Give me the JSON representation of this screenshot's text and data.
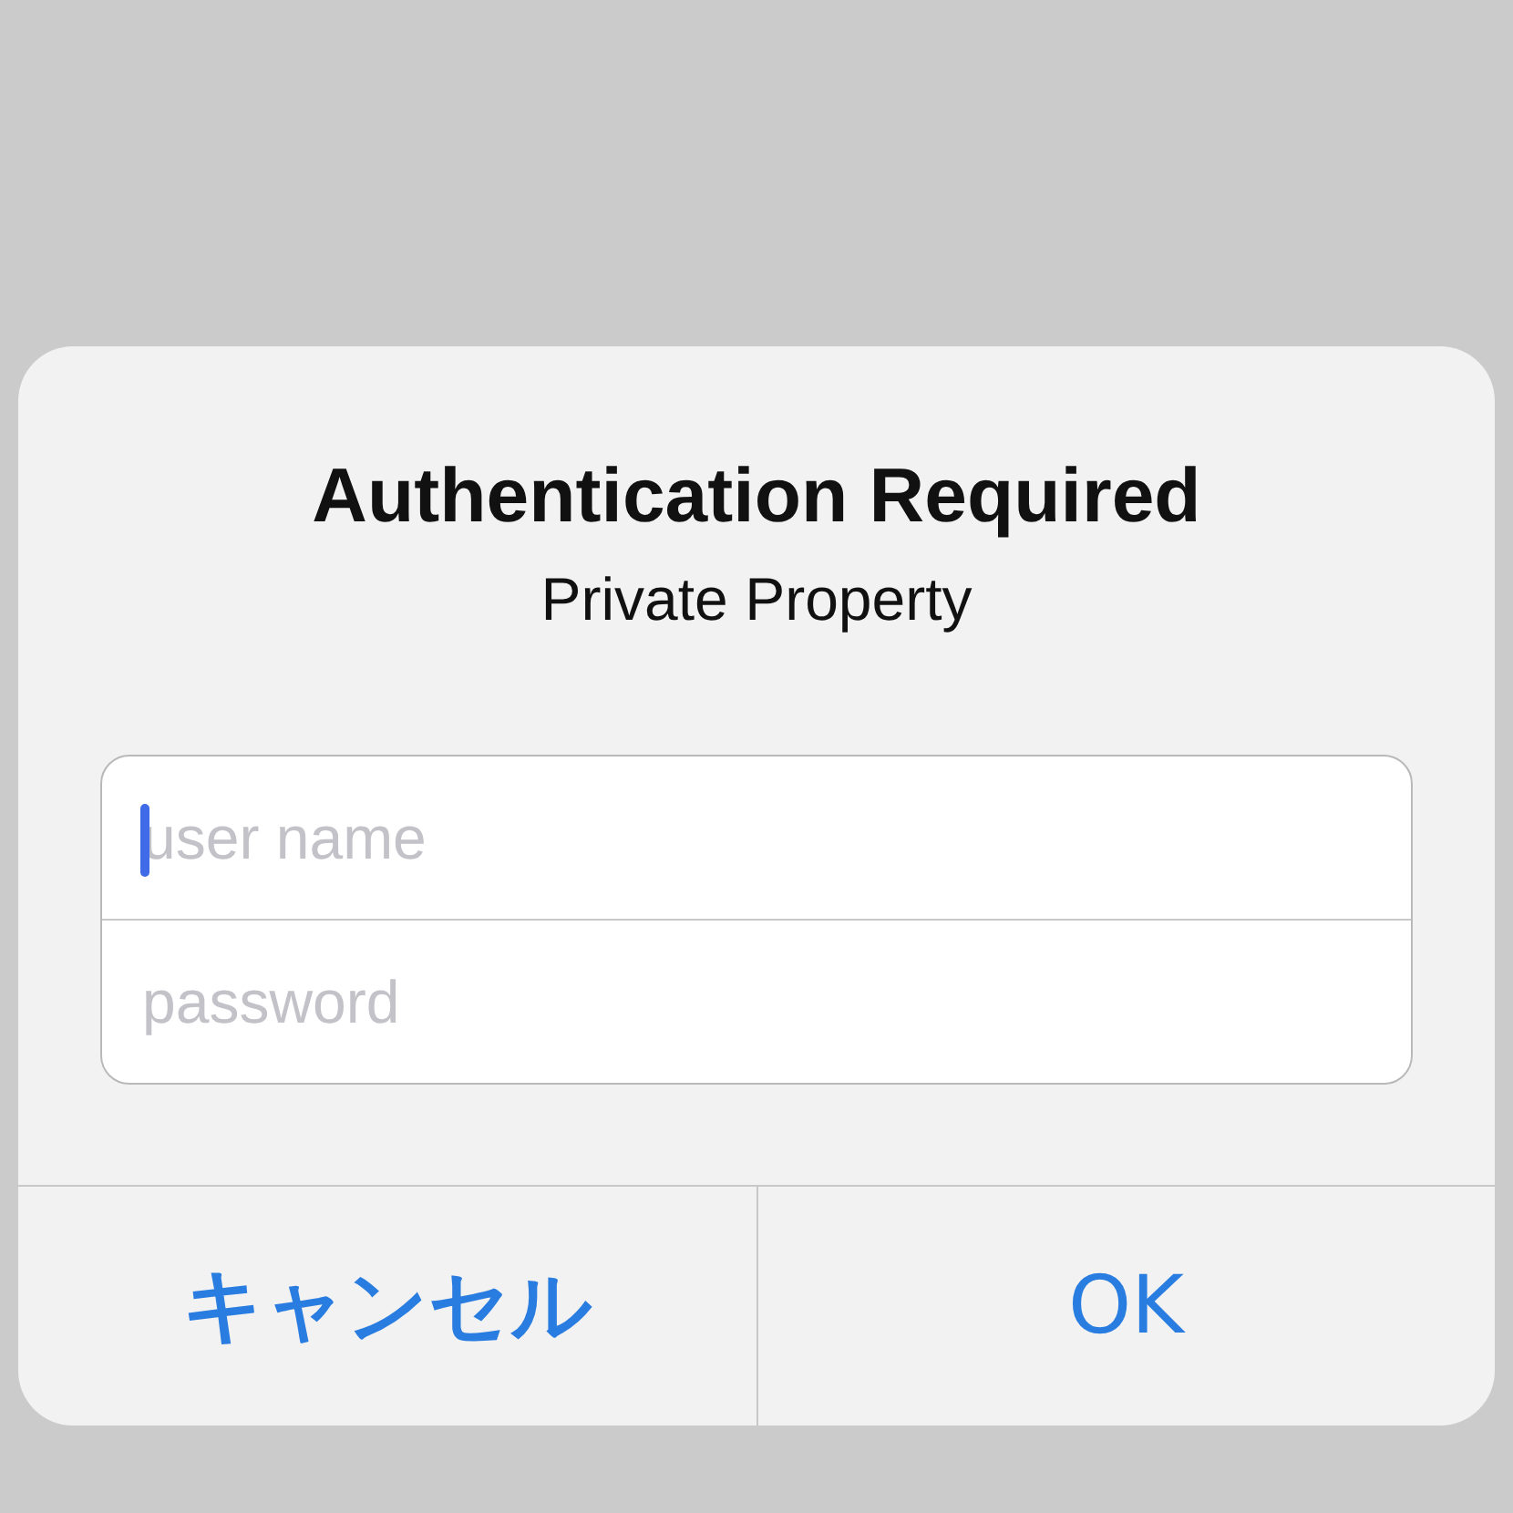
{
  "dialog": {
    "title": "Authentication Required",
    "message": "Private Property"
  },
  "fields": [
    {
      "placeholder": "user name",
      "focused": true
    },
    {
      "placeholder": "password",
      "focused": false
    }
  ],
  "buttons": [
    {
      "label": "キャンセル",
      "bold": true
    },
    {
      "label": "OK",
      "bold": false
    }
  ]
}
